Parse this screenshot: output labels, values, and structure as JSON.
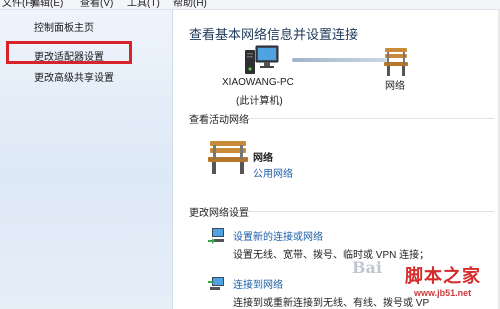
{
  "menu": [
    "文件(F)",
    "编辑(E)",
    "查看(V)",
    "工具(T)",
    "帮助(H)"
  ],
  "sidebar": {
    "items": [
      {
        "label": "控制面板主页"
      },
      {
        "label": "更改适配器设置"
      },
      {
        "label": "更改高级共享设置"
      }
    ]
  },
  "main": {
    "title": "查看基本网络信息并设置连接",
    "computer_name": "XIAOWANG-PC",
    "computer_sub": "(此计算机)",
    "network_label": "网络",
    "active_section": "查看活动网络",
    "active_network_name": "网络",
    "active_network_type": "公用网络",
    "change_section": "更改网络设置",
    "tasks": [
      {
        "link": "设置新的连接或网络",
        "desc": "设置无线、宽带、拨号、临时或 VPN 连接；"
      },
      {
        "link": "连接到网络",
        "desc": "连接到或重新连接到无线、有线、拨号或 VP"
      }
    ]
  },
  "watermark": {
    "baidu": "Bai",
    "site": "脚本之家",
    "url": "www.jb51.net"
  },
  "colors": {
    "highlight": "#d9232a",
    "title": "#1e395b",
    "link": "#1e5fa8",
    "watermark": "#d52b2b"
  }
}
